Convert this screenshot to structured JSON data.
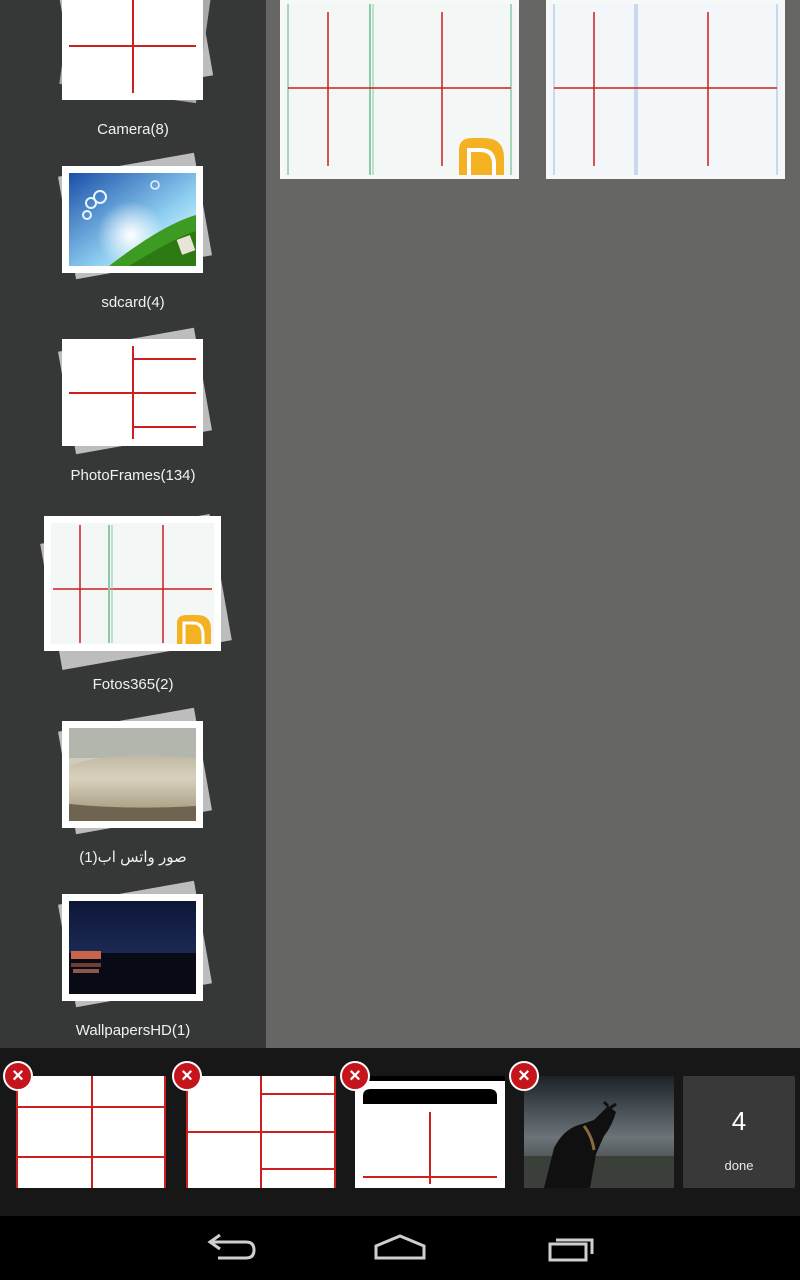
{
  "albums": [
    {
      "label": "Camera(8)"
    },
    {
      "label": "sdcard(4)"
    },
    {
      "label": "PhotoFrames(134)"
    },
    {
      "label": "Fotos365(2)"
    },
    {
      "label": "صور واتس اب(1)"
    },
    {
      "label": "WallpapersHD(1)"
    }
  ],
  "tray": {
    "done_count": "4",
    "done_label": "done",
    "remove_symbol": "×"
  },
  "icons": {
    "remove": "remove-circle-icon",
    "back": "back-icon",
    "home": "home-icon",
    "recents": "recent-apps-icon"
  },
  "colors": {
    "sidebar": "#363737",
    "main": "#666765",
    "tray": "#171717",
    "accent_red": "#c5141c",
    "grid_line": "#cc1f1f"
  }
}
